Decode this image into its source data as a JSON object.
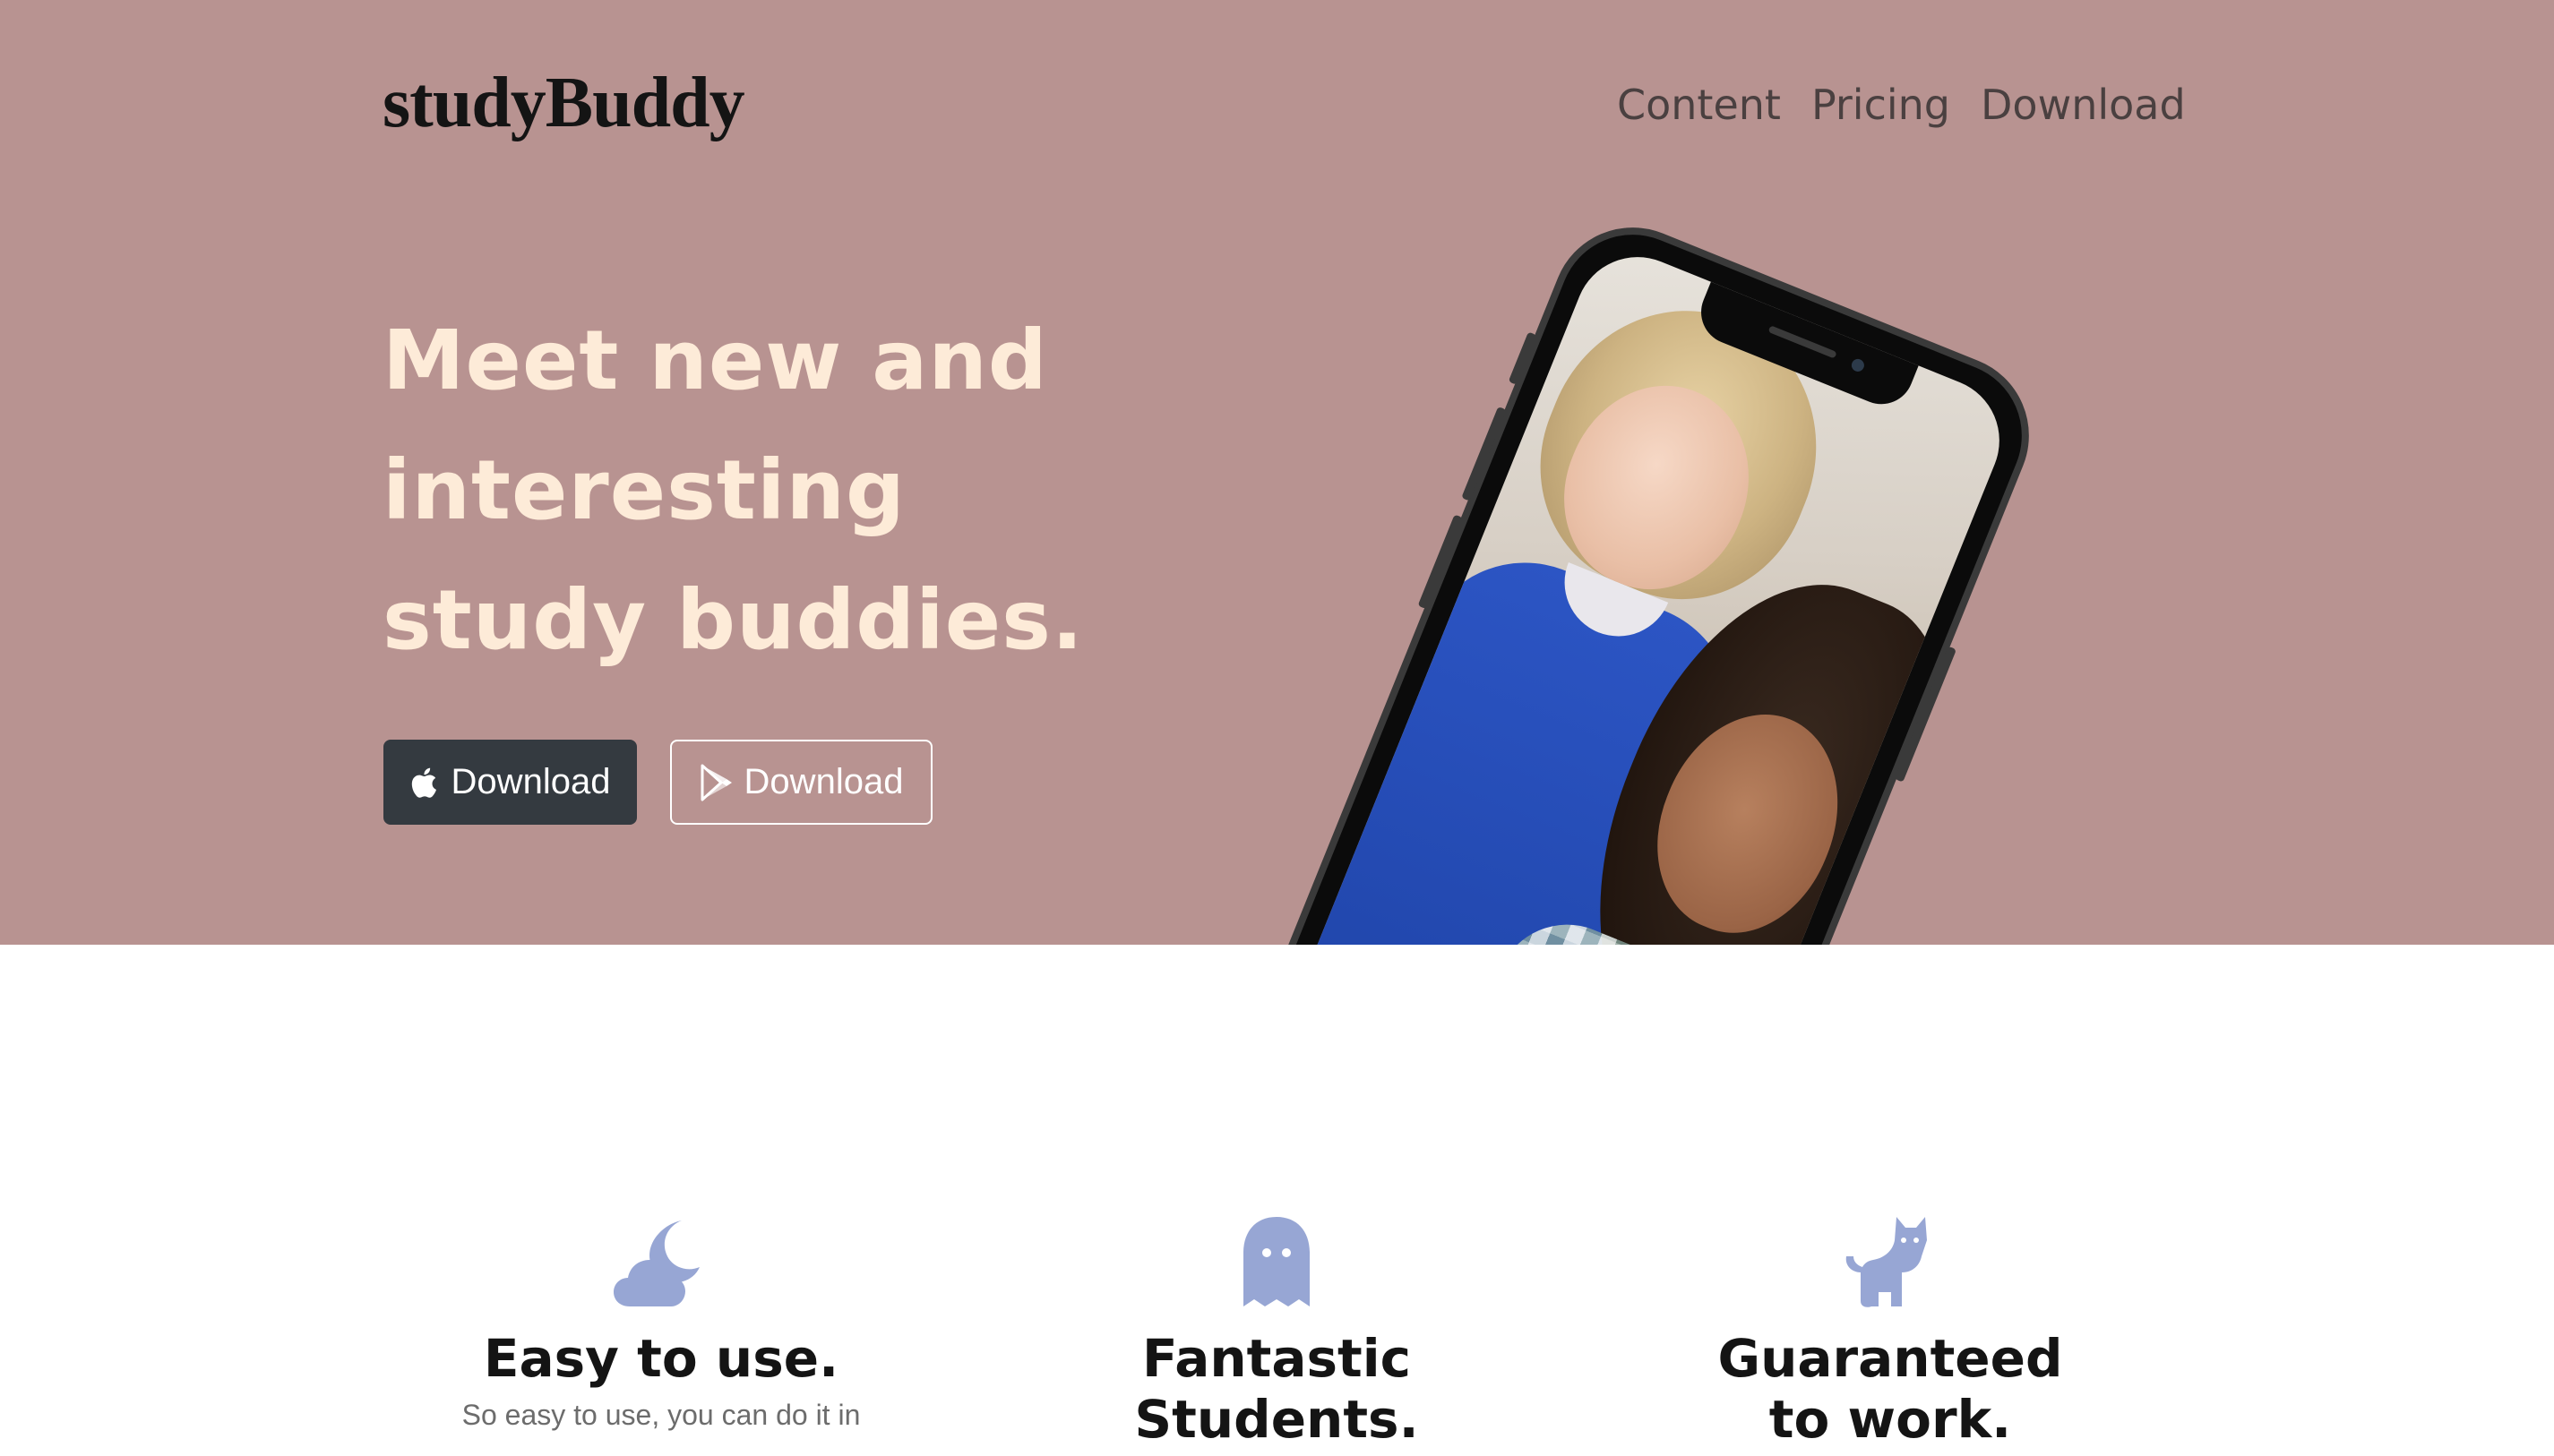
{
  "brand": {
    "name": "studyBuddy"
  },
  "nav": {
    "items": [
      {
        "label": "Content"
      },
      {
        "label": "Pricing"
      },
      {
        "label": "Download"
      }
    ]
  },
  "hero": {
    "headline": "Meet new and interesting study buddies.",
    "buttons": {
      "apple": {
        "label": "Download",
        "icon": "apple-icon"
      },
      "play": {
        "label": "Download",
        "icon": "google-play-icon"
      }
    },
    "image": {
      "subject": "phone-icon"
    }
  },
  "features": [
    {
      "icon": "cloud-moon-icon",
      "title": "Easy to use.",
      "text": "So easy to use, you can do it in"
    },
    {
      "icon": "ghost-icon",
      "title": "Fantastic Students.",
      "text": ""
    },
    {
      "icon": "cat-icon",
      "title": "Guaranteed to work.",
      "text": ""
    }
  ],
  "colors": {
    "hero_bg": "#b89391",
    "headline": "#fdebd8",
    "icon": "#97a6d4",
    "dark_button": "#343a40",
    "white": "#ffffff"
  }
}
